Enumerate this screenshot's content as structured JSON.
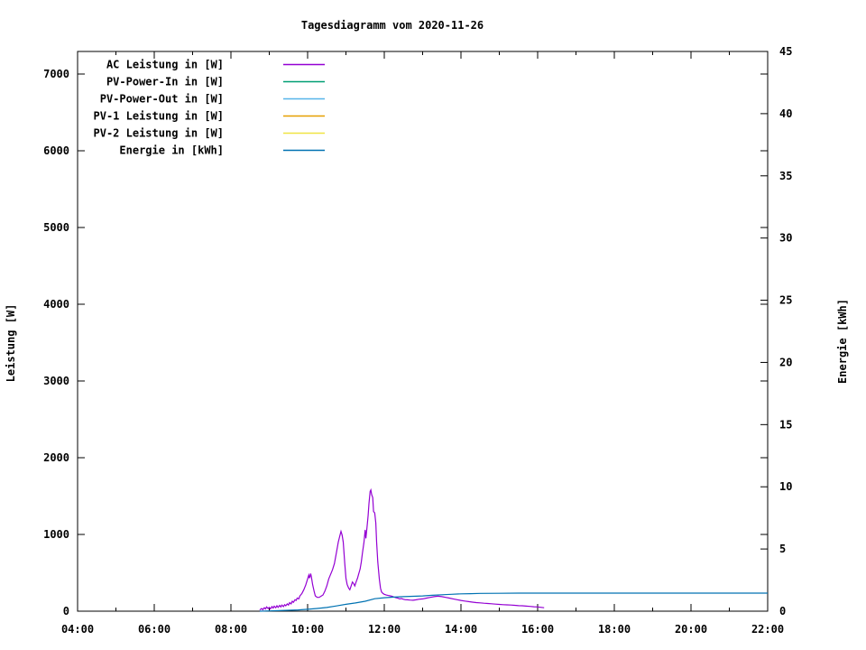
{
  "title": "Tagesdiagramm vom 2020-11-26",
  "chart_data": {
    "type": "line",
    "title": "Tagesdiagramm vom 2020-11-26",
    "grid": false,
    "legend_position": "top-left-inside",
    "x_axis": {
      "label": "",
      "range_hours": [
        4,
        22
      ],
      "major_step_hours": 2,
      "minor_step_hours": 1,
      "major_tick_labels": [
        "04:00",
        "06:00",
        "08:00",
        "10:00",
        "12:00",
        "14:00",
        "16:00",
        "18:00",
        "20:00",
        "22:00"
      ]
    },
    "y_axis": {
      "label": "Leistung [W]",
      "range": [
        0,
        7290
      ],
      "tick_values": [
        0,
        1000,
        2000,
        3000,
        4000,
        5000,
        6000,
        7000
      ]
    },
    "y2_axis": {
      "label": "Energie [kWh]",
      "range": [
        0,
        45
      ],
      "tick_values": [
        0,
        5,
        10,
        15,
        20,
        25,
        30,
        35,
        40,
        45
      ]
    },
    "series": [
      {
        "name": "AC Leistung in [W]",
        "color": "#9400d3",
        "axis": "y1",
        "points": [
          [
            8.75,
            15
          ],
          [
            8.8,
            35
          ],
          [
            8.83,
            20
          ],
          [
            8.87,
            45
          ],
          [
            8.9,
            30
          ],
          [
            8.93,
            55
          ],
          [
            8.97,
            35
          ],
          [
            9.0,
            50
          ],
          [
            9.03,
            30
          ],
          [
            9.07,
            60
          ],
          [
            9.1,
            40
          ],
          [
            9.13,
            65
          ],
          [
            9.17,
            45
          ],
          [
            9.2,
            70
          ],
          [
            9.23,
            50
          ],
          [
            9.27,
            75
          ],
          [
            9.3,
            55
          ],
          [
            9.33,
            80
          ],
          [
            9.37,
            60
          ],
          [
            9.4,
            85
          ],
          [
            9.43,
            70
          ],
          [
            9.47,
            95
          ],
          [
            9.5,
            80
          ],
          [
            9.53,
            110
          ],
          [
            9.57,
            95
          ],
          [
            9.6,
            130
          ],
          [
            9.63,
            115
          ],
          [
            9.67,
            150
          ],
          [
            9.7,
            140
          ],
          [
            9.73,
            170
          ],
          [
            9.77,
            160
          ],
          [
            9.8,
            200
          ],
          [
            9.85,
            230
          ],
          [
            9.9,
            280
          ],
          [
            9.95,
            340
          ],
          [
            10.0,
            420
          ],
          [
            10.03,
            470
          ],
          [
            10.05,
            430
          ],
          [
            10.08,
            490
          ],
          [
            10.1,
            440
          ],
          [
            10.13,
            350
          ],
          [
            10.17,
            260
          ],
          [
            10.2,
            200
          ],
          [
            10.25,
            180
          ],
          [
            10.3,
            180
          ],
          [
            10.35,
            195
          ],
          [
            10.4,
            210
          ],
          [
            10.45,
            260
          ],
          [
            10.5,
            330
          ],
          [
            10.55,
            420
          ],
          [
            10.6,
            480
          ],
          [
            10.65,
            540
          ],
          [
            10.7,
            620
          ],
          [
            10.75,
            760
          ],
          [
            10.8,
            900
          ],
          [
            10.85,
            1000
          ],
          [
            10.87,
            1040
          ],
          [
            10.9,
            990
          ],
          [
            10.93,
            900
          ],
          [
            10.97,
            620
          ],
          [
            11.0,
            430
          ],
          [
            11.03,
            350
          ],
          [
            11.07,
            300
          ],
          [
            11.1,
            280
          ],
          [
            11.13,
            320
          ],
          [
            11.17,
            380
          ],
          [
            11.2,
            360
          ],
          [
            11.23,
            330
          ],
          [
            11.27,
            390
          ],
          [
            11.3,
            430
          ],
          [
            11.33,
            480
          ],
          [
            11.37,
            550
          ],
          [
            11.4,
            640
          ],
          [
            11.43,
            760
          ],
          [
            11.47,
            900
          ],
          [
            11.5,
            1060
          ],
          [
            11.52,
            950
          ],
          [
            11.55,
            1100
          ],
          [
            11.58,
            1250
          ],
          [
            11.6,
            1400
          ],
          [
            11.63,
            1560
          ],
          [
            11.65,
            1580
          ],
          [
            11.67,
            1520
          ],
          [
            11.7,
            1480
          ],
          [
            11.72,
            1300
          ],
          [
            11.75,
            1280
          ],
          [
            11.78,
            1150
          ],
          [
            11.8,
            900
          ],
          [
            11.83,
            640
          ],
          [
            11.87,
            420
          ],
          [
            11.9,
            300
          ],
          [
            11.93,
            250
          ],
          [
            11.97,
            230
          ],
          [
            12.0,
            220
          ],
          [
            12.05,
            210
          ],
          [
            12.1,
            205
          ],
          [
            12.15,
            200
          ],
          [
            12.2,
            195
          ],
          [
            12.25,
            185
          ],
          [
            12.3,
            175
          ],
          [
            12.35,
            170
          ],
          [
            12.4,
            160
          ],
          [
            12.45,
            165
          ],
          [
            12.5,
            155
          ],
          [
            12.55,
            150
          ],
          [
            12.6,
            148
          ],
          [
            12.67,
            145
          ],
          [
            12.75,
            142
          ],
          [
            12.83,
            148
          ],
          [
            12.9,
            155
          ],
          [
            13.0,
            160
          ],
          [
            13.1,
            170
          ],
          [
            13.2,
            180
          ],
          [
            13.3,
            190
          ],
          [
            13.4,
            195
          ],
          [
            13.5,
            190
          ],
          [
            13.6,
            180
          ],
          [
            13.7,
            170
          ],
          [
            13.8,
            160
          ],
          [
            13.9,
            150
          ],
          [
            14.0,
            140
          ],
          [
            14.1,
            132
          ],
          [
            14.2,
            125
          ],
          [
            14.3,
            118
          ],
          [
            14.4,
            112
          ],
          [
            14.5,
            108
          ],
          [
            14.6,
            104
          ],
          [
            14.7,
            100
          ],
          [
            14.8,
            96
          ],
          [
            14.9,
            92
          ],
          [
            15.0,
            88
          ],
          [
            15.1,
            85
          ],
          [
            15.2,
            82
          ],
          [
            15.3,
            80
          ],
          [
            15.4,
            76
          ],
          [
            15.5,
            72
          ],
          [
            15.6,
            70
          ],
          [
            15.7,
            66
          ],
          [
            15.8,
            62
          ],
          [
            15.9,
            58
          ],
          [
            16.0,
            55
          ],
          [
            16.1,
            50
          ],
          [
            16.17,
            45
          ]
        ]
      },
      {
        "name": "PV-Power-In in [W]",
        "color": "#009e73",
        "axis": "y1",
        "points": []
      },
      {
        "name": "PV-Power-Out in [W]",
        "color": "#56b4e9",
        "axis": "y1",
        "points": []
      },
      {
        "name": "PV-1 Leistung in [W]",
        "color": "#e69f00",
        "axis": "y1",
        "points": []
      },
      {
        "name": "PV-2 Leistung in [W]",
        "color": "#f0e442",
        "axis": "y1",
        "points": []
      },
      {
        "name": "Energie in [kWh]",
        "color": "#0072b2",
        "axis": "y2",
        "points": [
          [
            8.75,
            0.0
          ],
          [
            9.0,
            0.02
          ],
          [
            9.25,
            0.04
          ],
          [
            9.5,
            0.07
          ],
          [
            9.75,
            0.1
          ],
          [
            10.0,
            0.15
          ],
          [
            10.25,
            0.22
          ],
          [
            10.5,
            0.3
          ],
          [
            10.75,
            0.42
          ],
          [
            11.0,
            0.55
          ],
          [
            11.25,
            0.66
          ],
          [
            11.5,
            0.8
          ],
          [
            11.75,
            1.0
          ],
          [
            12.0,
            1.08
          ],
          [
            12.25,
            1.13
          ],
          [
            12.5,
            1.17
          ],
          [
            12.75,
            1.2
          ],
          [
            13.0,
            1.23
          ],
          [
            13.25,
            1.28
          ],
          [
            13.5,
            1.32
          ],
          [
            13.75,
            1.36
          ],
          [
            14.0,
            1.39
          ],
          [
            14.25,
            1.41
          ],
          [
            14.5,
            1.43
          ],
          [
            15.0,
            1.44
          ],
          [
            15.5,
            1.45
          ],
          [
            16.0,
            1.45
          ],
          [
            18.0,
            1.45
          ],
          [
            20.0,
            1.45
          ],
          [
            22.0,
            1.45
          ]
        ]
      }
    ]
  }
}
